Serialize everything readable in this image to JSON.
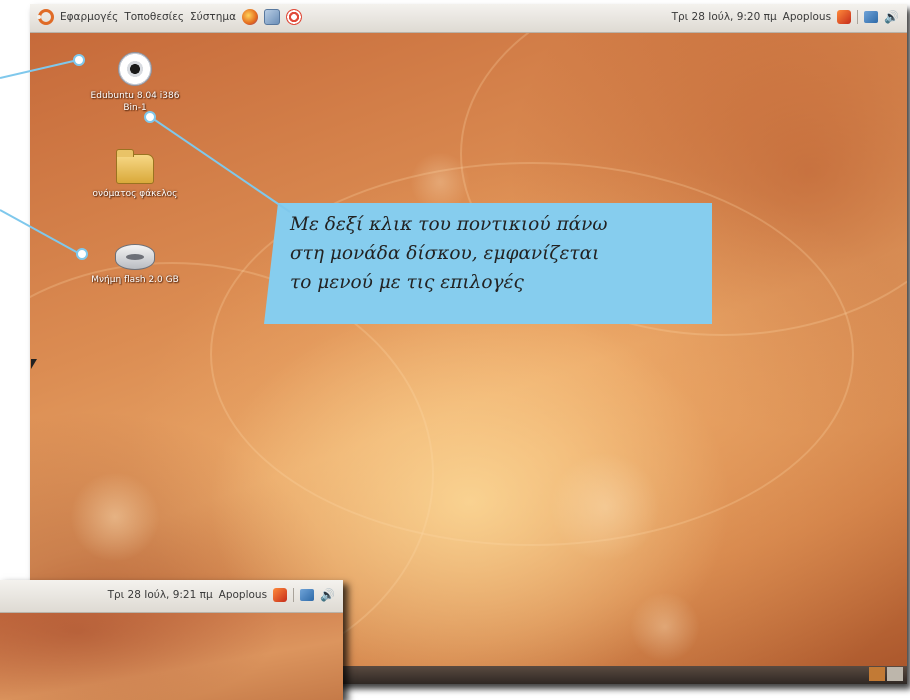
{
  "top_panel": {
    "menus": [
      "Εφαρμογές",
      "Τοποθεσίες",
      "Σύστημα"
    ],
    "launchers": [
      "firefox-icon",
      "mail-icon",
      "help-icon"
    ],
    "clock": "Τρι 28 Ιούλ,  9:20 πμ",
    "user": "Apoplous"
  },
  "desktop": {
    "icons": [
      {
        "label_line1": "Edubuntu 8.04 i386",
        "label_line2": "Bin-1",
        "icon": "cd-icon"
      },
      {
        "label_line1": "ονόματος φάκελος",
        "label_line2": "",
        "icon": "folder-icon"
      },
      {
        "label_line1": "Μνήμη flash 2.0 GB",
        "label_line2": "",
        "icon": "drive-icon"
      }
    ]
  },
  "callout": {
    "lines": [
      "Με δεξί κλικ του ποντικιού πάνω",
      "στη μονάδα δίσκου, εμφανίζεται",
      "το μενού με τις επιλογές"
    ]
  },
  "second_panel": {
    "clock": "Τρι 28 Ιούλ,  9:21 πμ",
    "user": "Apoplous"
  },
  "colors": {
    "callout_bg": "#86cdee",
    "connector": "#7fc8ec",
    "wallpaper": "#d98f52",
    "panel": "#ebe8e3"
  }
}
